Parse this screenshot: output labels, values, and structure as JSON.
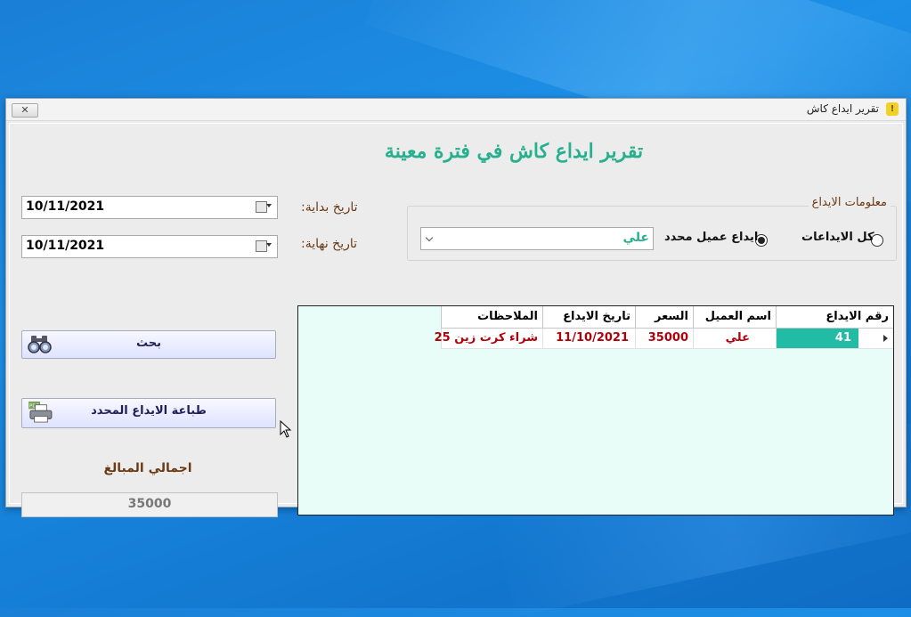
{
  "window": {
    "title": "تقرير ايداع كاش",
    "close_label": "✕"
  },
  "form": {
    "heading": "تقرير ايداع كاش في فترة معينة"
  },
  "dates": {
    "start_label": "تاريخ بداية:",
    "start_value": "10/11/2021",
    "end_label": "تاريخ نهاية:",
    "end_value": "10/11/2021"
  },
  "deposit_info": {
    "group_title": "معلومات الايداع",
    "option_all": "كل الايداعات",
    "option_specific": "ايداع عميل محدد",
    "selected_option": "option_specific",
    "customer_value": "علي"
  },
  "buttons": {
    "search": "بحث",
    "print": "طباعة الايداع المحدد"
  },
  "total": {
    "label": "اجمالي المبالغ",
    "value": "35000"
  },
  "table": {
    "columns": [
      "رقم الايداع",
      "اسم العميل",
      "السعر",
      "تاريخ الايداع",
      "الملاحظات"
    ],
    "rows": [
      {
        "id": "41",
        "customer": "علي",
        "price": "35000",
        "date": "11/10/2021",
        "notes": "شراء كرت زين 25"
      }
    ]
  },
  "colors": {
    "accent": "#27b08e",
    "label_brown": "#6b3a14",
    "cell_red": "#b0000a",
    "selected_cell": "#21bba6",
    "grid_bg": "#e8fdf8"
  }
}
